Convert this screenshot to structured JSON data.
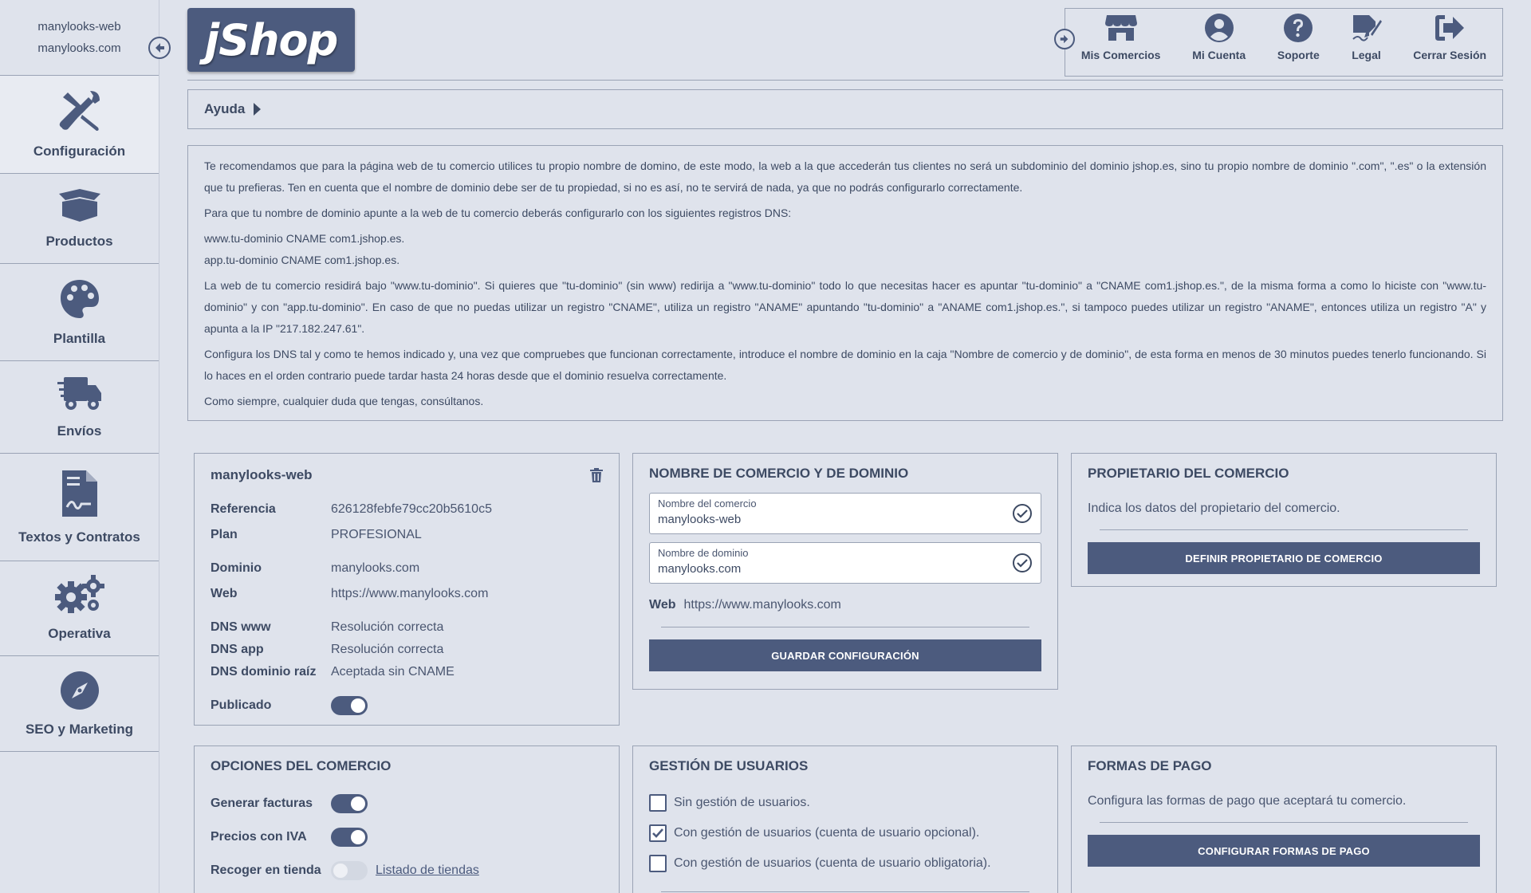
{
  "sidebar": {
    "shop_name": "manylooks-web",
    "shop_domain": "manylooks.com",
    "items": [
      {
        "label": "Configuración",
        "icon": "tools-icon"
      },
      {
        "label": "Productos",
        "icon": "box-icon"
      },
      {
        "label": "Plantilla",
        "icon": "palette-icon"
      },
      {
        "label": "Envíos",
        "icon": "truck-icon"
      },
      {
        "label": "Textos y Contratos",
        "icon": "contract-icon"
      },
      {
        "label": "Operativa",
        "icon": "gears-icon"
      },
      {
        "label": "SEO y Marketing",
        "icon": "compass-icon"
      }
    ]
  },
  "header": {
    "logo_text": "jShop",
    "nav": [
      {
        "label": "Mis Comercios",
        "icon": "store-icon"
      },
      {
        "label": "Mi Cuenta",
        "icon": "user-icon"
      },
      {
        "label": "Soporte",
        "icon": "question-icon"
      },
      {
        "label": "Legal",
        "icon": "signature-icon"
      },
      {
        "label": "Cerrar Sesión",
        "icon": "logout-icon"
      }
    ]
  },
  "help": {
    "label": "Ayuda",
    "paragraphs": [
      "Te recomendamos que para la página web de tu comercio utilices tu propio nombre de domino, de este modo, la web a la que accederán tus clientes no será un subdominio del dominio jshop.es, sino tu propio nombre de dominio \".com\", \".es\" o la extensión que tu prefieras. Ten en cuenta que el nombre de dominio debe ser de tu propiedad, si no es así, no te servirá de nada, ya que no podrás configurarlo correctamente.",
      "Para que tu nombre de dominio apunte a la web de tu comercio deberás configurarlo con los siguientes registros DNS:",
      "www.tu-dominio CNAME com1.jshop.es.",
      "app.tu-dominio CNAME com1.jshop.es.",
      "La web de tu comercio residirá bajo \"www.tu-dominio\". Si quieres que \"tu-dominio\" (sin www) redirija a \"www.tu-dominio\" todo lo que necesitas hacer es apuntar \"tu-dominio\" a \"CNAME com1.jshop.es.\", de la misma forma a como lo hiciste con \"www.tu-dominio\" y con \"app.tu-dominio\". En caso de que no puedas utilizar un registro \"CNAME\", utiliza un registro \"ANAME\" apuntando \"tu-dominio\" a \"ANAME com1.jshop.es.\", si tampoco puedes utilizar un registro \"ANAME\", entonces utiliza un registro \"A\" y apunta a la IP \"217.182.247.61\".",
      "Configura los DNS tal y como te hemos indicado y, una vez que compruebes que funcionan correctamente, introduce el nombre de dominio en la caja \"Nombre de comercio y de dominio\", de esta forma en menos de 30 minutos puedes tenerlo funcionando. Si lo haces en el orden contrario puede tardar hasta 24 horas desde que el dominio resuelva correctamente.",
      "Como siempre, cualquier duda que tengas, consúltanos."
    ]
  },
  "shop_card": {
    "title": "manylooks-web",
    "rows": [
      {
        "key": "Referencia",
        "value": "626128febfe79cc20b5610c5"
      },
      {
        "key": "Plan",
        "value": "PROFESIONAL"
      },
      {
        "key": "Dominio",
        "value": "manylooks.com"
      },
      {
        "key": "Web",
        "value": "https://www.manylooks.com"
      },
      {
        "key": "DNS www",
        "value": "Resolución correcta"
      },
      {
        "key": "DNS app",
        "value": "Resolución correcta"
      },
      {
        "key": "DNS dominio raíz",
        "value": "Aceptada sin CNAME"
      }
    ],
    "published_label": "Publicado",
    "published": true
  },
  "domain_card": {
    "title": "NOMBRE DE COMERCIO Y DE DOMINIO",
    "shop_name_label": "Nombre del comercio",
    "shop_name_value": "manylooks-web",
    "domain_label": "Nombre de dominio",
    "domain_value": "manylooks.com",
    "web_label": "Web",
    "web_value": "https://www.manylooks.com",
    "save_button": "GUARDAR CONFIGURACIÓN"
  },
  "owner_card": {
    "title": "PROPIETARIO DEL COMERCIO",
    "text": "Indica los datos del propietario del comercio.",
    "button": "DEFINIR PROPIETARIO DE COMERCIO"
  },
  "options_card": {
    "title": "OPCIONES DEL COMERCIO",
    "options": [
      {
        "label": "Generar facturas",
        "on": true
      },
      {
        "label": "Precios con IVA",
        "on": true
      },
      {
        "label": "Recoger en tienda",
        "on": false
      }
    ],
    "stores_link": "Listado de tiendas"
  },
  "users_card": {
    "title": "GESTIÓN DE USUARIOS",
    "options": [
      {
        "label": "Sin gestión de usuarios.",
        "checked": false
      },
      {
        "label": "Con gestión de usuarios (cuenta de usuario opcional).",
        "checked": true
      },
      {
        "label": "Con gestión de usuarios (cuenta de usuario obligatoria).",
        "checked": false
      }
    ]
  },
  "payment_card": {
    "title": "FORMAS DE PAGO",
    "text": "Configura las formas de pago que aceptará tu comercio.",
    "button": "CONFIGURAR FORMAS DE PAGO"
  },
  "colors": {
    "accent": "#4c5b7e",
    "background": "#dfe3ec",
    "text": "#3d4a63"
  }
}
